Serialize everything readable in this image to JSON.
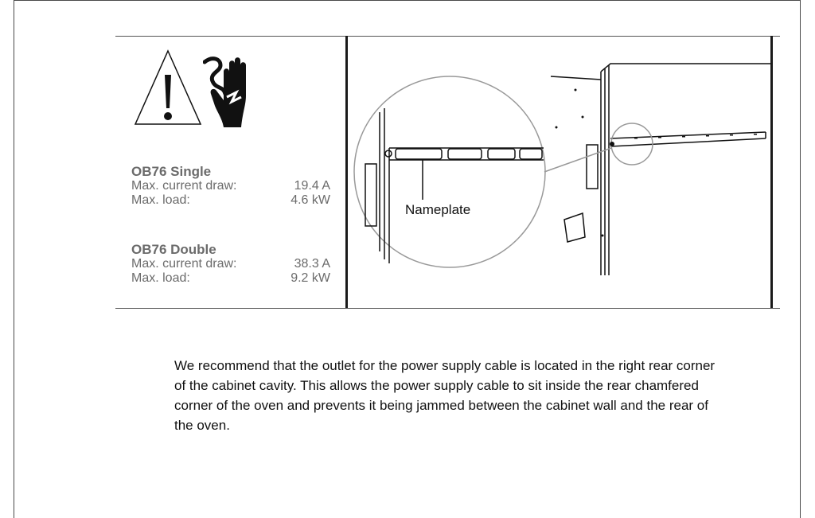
{
  "specs": [
    {
      "model": "OB76 Single",
      "rows": [
        {
          "label": "Max. current draw:",
          "value": "19.4 A"
        },
        {
          "label": "Max. load:",
          "value": "4.6 kW"
        }
      ]
    },
    {
      "model": "OB76 Double",
      "rows": [
        {
          "label": "Max. current draw:",
          "value": "38.3 A"
        },
        {
          "label": "Max. load:",
          "value": "9.2 kW"
        }
      ]
    }
  ],
  "diagram": {
    "callout": "Nameplate"
  },
  "body_text": "We recommend that the outlet for the power supply cable is located in the right rear corner of the cabinet cavity. This allows the power supply cable to sit inside the rear chamfered corner of the oven and prevents it being jammed between the cabinet wall and the rear of the oven.",
  "icons": [
    "warning-triangle-icon",
    "electric-shock-hand-icon"
  ]
}
